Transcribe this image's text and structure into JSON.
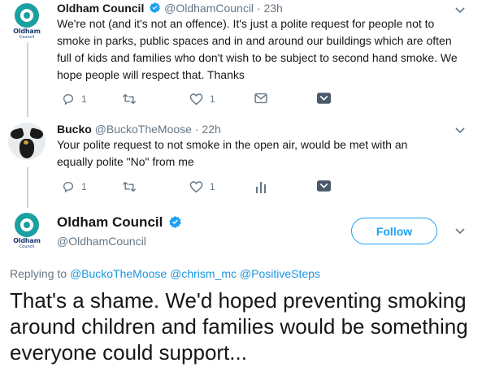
{
  "tweets": [
    {
      "name": "Oldham Council",
      "handle": "@OldhamCouncil",
      "time": "· 23h",
      "text": "We're not (and it's not an offence). It's just a polite request for people not to smoke in parks, public spaces and in and around our buildings which are often full of kids and families who don't wish to be subject to second hand smoke. We hope people will respect that. Thanks",
      "replies": "1",
      "likes": "1",
      "avatar_word": "Oldham",
      "avatar_sub": "Council"
    },
    {
      "name": "Bucko",
      "handle": "@BuckoTheMoose",
      "time": "· 22h",
      "text": "Your polite request to not smoke in the open air, would be met with an equally polite \"No\" from me",
      "replies": "1",
      "likes": "1"
    }
  ],
  "main_tweet": {
    "name": "Oldham Council",
    "handle": "@OldhamCouncil",
    "follow_label": "Follow",
    "replying_prefix": "Replying to",
    "replying_to": [
      "@BuckoTheMoose",
      "@chrism_mc",
      "@PositiveSteps"
    ],
    "text": "That's a shame. We'd hoped preventing smoking around children and families would be something everyone could support...",
    "avatar_word": "Oldham",
    "avatar_sub": "Council"
  },
  "colors": {
    "accent": "#1da1f2",
    "secondary_text": "#657786",
    "verified": "#1da1f2"
  }
}
